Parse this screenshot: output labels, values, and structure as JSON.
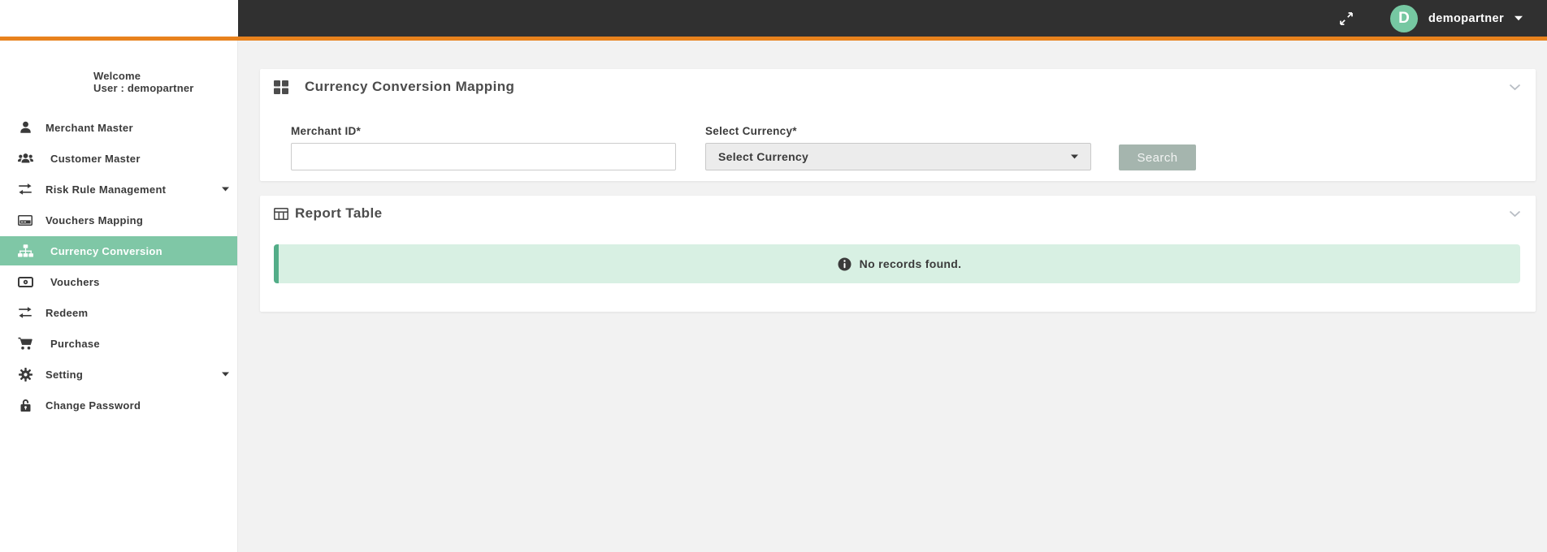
{
  "topbar": {
    "user_name": "demopartner",
    "avatar_letter": "D",
    "expand_icon": "expand-arrows-icon",
    "caret_icon": "caret-down-icon"
  },
  "sidebar": {
    "welcome_line1": "Welcome",
    "welcome_line2": "User : demopartner",
    "items": [
      {
        "label": "Merchant Master",
        "icon": "user-icon",
        "active": false,
        "has_caret": false,
        "indent": false
      },
      {
        "label": "Customer Master",
        "icon": "users-icon",
        "active": false,
        "has_caret": false,
        "indent": true
      },
      {
        "label": "Risk Rule Management",
        "icon": "exchange-icon",
        "active": false,
        "has_caret": true,
        "indent": false
      },
      {
        "label": "Vouchers Mapping",
        "icon": "credit-card-icon",
        "active": false,
        "has_caret": false,
        "indent": false
      },
      {
        "label": "Currency Conversion",
        "icon": "sitemap-icon",
        "active": true,
        "has_caret": false,
        "indent": true
      },
      {
        "label": "Vouchers",
        "icon": "money-bill-icon",
        "active": false,
        "has_caret": false,
        "indent": true
      },
      {
        "label": "Redeem",
        "icon": "exchange-icon",
        "active": false,
        "has_caret": false,
        "indent": false
      },
      {
        "label": "Purchase",
        "icon": "cart-icon",
        "active": false,
        "has_caret": false,
        "indent": true
      },
      {
        "label": "Setting",
        "icon": "gear-icon",
        "active": false,
        "has_caret": true,
        "indent": false
      },
      {
        "label": "Change Password",
        "icon": "lock-icon",
        "active": false,
        "has_caret": false,
        "indent": false
      }
    ]
  },
  "panels": {
    "mapping": {
      "title": "Currency Conversion Mapping",
      "icon": "grid-icon",
      "collapse_icon": "chevron-down-icon"
    },
    "report": {
      "title": "Report Table",
      "icon": "table-icon",
      "collapse_icon": "chevron-down-icon"
    }
  },
  "form": {
    "merchant_id": {
      "label": "Merchant ID*",
      "value": "",
      "placeholder": ""
    },
    "currency": {
      "label": "Select Currency*",
      "selected": "Select Currency"
    },
    "search_label": "Search"
  },
  "report": {
    "empty_message": "No records found.",
    "info_icon": "info-circle-icon"
  },
  "colors": {
    "topbar_bg": "#303030",
    "accent_orange": "#e8821d",
    "active_green": "#7fc7a6",
    "avatar_green": "#76c8a2",
    "alert_bg": "#d8f0e3",
    "alert_border": "#53ad88",
    "search_button_bg": "#a5b5ae"
  }
}
